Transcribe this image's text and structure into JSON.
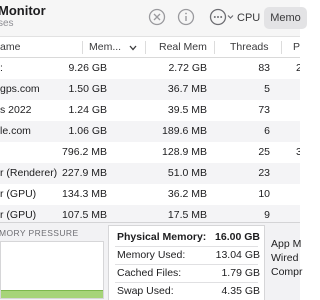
{
  "window": {
    "title": "Monitor",
    "subtitle": "ses"
  },
  "toolbar": {
    "tabs": [
      {
        "label": "CPU",
        "selected": false
      },
      {
        "label": "Memo",
        "selected": true
      }
    ]
  },
  "table": {
    "columns": {
      "name": "ame",
      "memory": "Mem...",
      "real_mem": "Real Mem",
      "threads": "Threads",
      "ports": "P"
    },
    "rows": [
      {
        "name": ":",
        "memory": "9.26 GB",
        "real_mem": "2.72 GB",
        "threads": "83",
        "ports": "2"
      },
      {
        "name": "gps.com",
        "memory": "1.50 GB",
        "real_mem": "36.7 MB",
        "threads": "5",
        "ports": ""
      },
      {
        "name": "s 2022",
        "memory": "1.24 GB",
        "real_mem": "39.5 MB",
        "threads": "73",
        "ports": ""
      },
      {
        "name": "le.com",
        "memory": "1.06 GB",
        "real_mem": "189.6 MB",
        "threads": "6",
        "ports": ""
      },
      {
        "name": "",
        "memory": "796.2 MB",
        "real_mem": "128.9 MB",
        "threads": "25",
        "ports": "3"
      },
      {
        "name": "r (Renderer)",
        "memory": "227.9 MB",
        "real_mem": "51.0 MB",
        "threads": "23",
        "ports": ""
      },
      {
        "name": "r (GPU)",
        "memory": "134.3 MB",
        "real_mem": "36.2 MB",
        "threads": "10",
        "ports": ""
      },
      {
        "name": "r (GPU)",
        "memory": "107.5 MB",
        "real_mem": "17.5 MB",
        "threads": "9",
        "ports": ""
      }
    ]
  },
  "bottom": {
    "pressure_title": "MORY PRESSURE",
    "pressure_level": 0.15,
    "stats": [
      {
        "label": "Physical Memory:",
        "value": "16.00 GB",
        "bold": true
      },
      {
        "label": "Memory Used:",
        "value": "13.04 GB",
        "bold": false
      },
      {
        "label": "Cached Files:",
        "value": "1.79 GB",
        "bold": false
      },
      {
        "label": "Swap Used:",
        "value": "4.35 GB",
        "bold": false
      }
    ],
    "legend": [
      "App M",
      "Wired",
      "Compr"
    ]
  },
  "colors": {
    "pressure_green": "#a6d479",
    "selected_tab": "#e3e3e5"
  }
}
